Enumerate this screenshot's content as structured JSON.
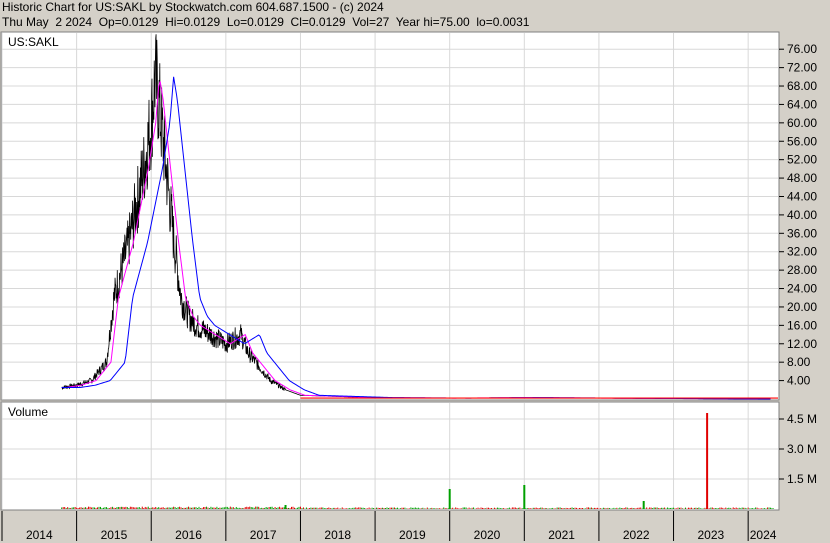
{
  "header": {
    "line1": "Historic Chart for US:SAKL by Stockwatch.com 604.687.1500 - (c) 2024",
    "line2": "Thu May  2 2024  Op=0.0129  Hi=0.0129  Lo=0.0129  Cl=0.0129  Vol=27  Year hi=75.00  lo=0.0031"
  },
  "chart_data": [
    {
      "type": "line",
      "title": "US:SAKL",
      "ylim": [
        0,
        78
      ],
      "yticks": [
        4,
        8,
        12,
        16,
        20,
        24,
        28,
        32,
        36,
        40,
        44,
        48,
        52,
        56,
        60,
        64,
        68,
        72,
        76
      ],
      "ytick_labels": [
        "4.00",
        "8.00",
        "12.00",
        "16.00",
        "20.00",
        "24.00",
        "28.00",
        "32.00",
        "36.00",
        "40.00",
        "44.00",
        "48.00",
        "52.00",
        "56.00",
        "60.00",
        "64.00",
        "68.00",
        "72.00",
        "76.00"
      ],
      "grid": true,
      "colors": {
        "price": "#000000",
        "ma_short": "#ff00ff",
        "ma_long": "#0000ff",
        "baseline": "#ff0000"
      },
      "series": [
        {
          "values_x": [
            2014.8,
            2015.0,
            2015.2,
            2015.4,
            2015.5,
            2015.6,
            2015.7,
            2015.8,
            2015.9,
            2016.0,
            2016.05,
            2016.1,
            2016.2,
            2016.3,
            2016.4,
            2016.5,
            2016.6,
            2016.8,
            2017.0,
            2017.2,
            2017.3,
            2017.4,
            2017.5,
            2017.6,
            2017.8,
            2018.0,
            2019.0,
            2020.0,
            2021.0,
            2022.0,
            2023.0,
            2024.3
          ],
          "values_y": [
            2.5,
            3,
            4,
            8,
            22,
            28,
            34,
            42,
            50,
            60,
            70,
            65,
            50,
            35,
            22,
            18,
            16,
            14,
            12,
            14,
            10,
            8,
            6,
            4,
            2,
            0.8,
            0.3,
            0.2,
            0.3,
            0.2,
            0.1,
            0.0129
          ]
        }
      ]
    },
    {
      "type": "bar",
      "title": "Volume",
      "ylim": [
        0,
        5200000
      ],
      "yticks": [
        1500000,
        3000000,
        4500000
      ],
      "ytick_labels": [
        "1.5 M",
        "3.0 M",
        "4.5 M"
      ],
      "colors": {
        "up": "#00a000",
        "down": "#e00000"
      },
      "notable_bars": [
        {
          "x": 2017.8,
          "value": 200000
        },
        {
          "x": 2020.0,
          "value": 1000000
        },
        {
          "x": 2021.0,
          "value": 1200000
        },
        {
          "x": 2022.6,
          "value": 400000
        },
        {
          "x": 2023.45,
          "value": 4800000
        }
      ]
    }
  ],
  "x_axis": {
    "years": [
      "2014",
      "2015",
      "2016",
      "2017",
      "2018",
      "2019",
      "2020",
      "2021",
      "2022",
      "2023",
      "2024"
    ]
  }
}
